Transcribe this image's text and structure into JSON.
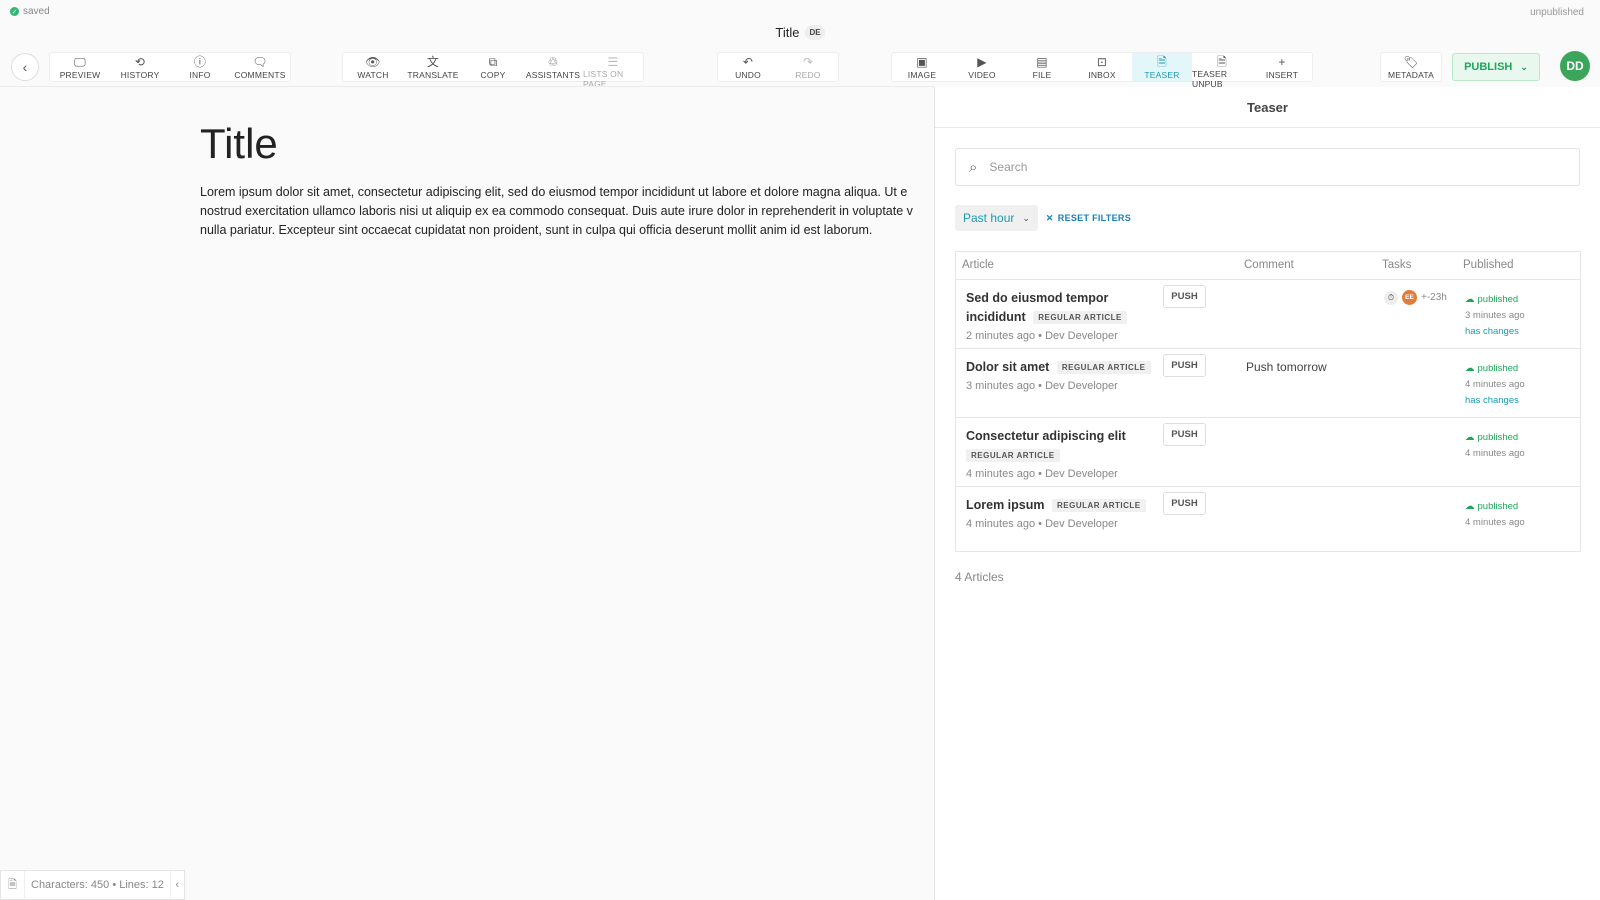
{
  "status": {
    "saved": "saved",
    "unpublished": "unpublished"
  },
  "document": {
    "title": "Title",
    "language": "DE"
  },
  "toolbar": {
    "group1": [
      {
        "icon": "preview-icon",
        "glyph": "🖵",
        "label": "PREVIEW"
      },
      {
        "icon": "history-icon",
        "glyph": "⟲",
        "label": "HISTORY"
      },
      {
        "icon": "info-icon",
        "glyph": "ⓘ",
        "label": "INFO"
      },
      {
        "icon": "comments-icon",
        "glyph": "🗨",
        "label": "COMMENTS"
      }
    ],
    "group2": [
      {
        "icon": "watch-icon",
        "glyph": "👁",
        "label": "WATCH"
      },
      {
        "icon": "translate-icon",
        "glyph": "文",
        "label": "TRANSLATE"
      },
      {
        "icon": "copy-icon",
        "glyph": "⧉",
        "label": "COPY"
      },
      {
        "icon": "assistants-icon",
        "glyph": "♲",
        "label": "ASSISTANTS"
      },
      {
        "icon": "lists-icon",
        "glyph": "☰",
        "label": "LISTS ON PAGE"
      }
    ],
    "group3": [
      {
        "icon": "undo-icon",
        "glyph": "↶",
        "label": "UNDO"
      },
      {
        "icon": "redo-icon",
        "glyph": "↷",
        "label": "REDO"
      }
    ],
    "group4": [
      {
        "icon": "image-icon",
        "glyph": "▣",
        "label": "IMAGE"
      },
      {
        "icon": "video-icon",
        "glyph": "▶",
        "label": "VIDEO"
      },
      {
        "icon": "file-icon",
        "glyph": "▤",
        "label": "FILE"
      },
      {
        "icon": "inbox-icon",
        "glyph": "⊡",
        "label": "INBOX"
      },
      {
        "icon": "teaser-icon",
        "glyph": "🗎",
        "label": "TEASER"
      },
      {
        "icon": "teaser-unpub-icon",
        "glyph": "🗎",
        "label": "TEASER UNPUB"
      },
      {
        "icon": "insert-icon",
        "glyph": "+",
        "label": "INSERT"
      }
    ],
    "metadata": {
      "icon": "tag-icon",
      "glyph": "🏷",
      "label": "METADATA"
    },
    "publish_label": "PUBLISH",
    "avatar_initials": "DD"
  },
  "editor": {
    "heading": "Title",
    "body_lines": [
      "Lorem ipsum dolor sit amet, consectetur adipiscing elit, sed do eiusmod tempor incididunt ut labore et dolore magna aliqua. Ut e",
      "nostrud exercitation ullamco laboris nisi ut aliquip ex ea commodo consequat. Duis aute irure dolor in reprehenderit in voluptate v",
      "nulla pariatur. Excepteur sint occaecat cupidatat non proident, sunt in culpa qui officia deserunt mollit anim id est laborum."
    ],
    "footer_stats": "Characters: 450 • Lines: 12"
  },
  "panel": {
    "title": "Teaser",
    "search_placeholder": "Search",
    "filter_selected": "Past hour",
    "reset_label": "RESET FILTERS",
    "columns": {
      "article": "Article",
      "comment": "Comment",
      "tasks": "Tasks",
      "published": "Published"
    },
    "rows": [
      {
        "title": "Sed do eiusmod tempor incididunt",
        "tag": "REGULAR ARTICLE",
        "meta": "2 minutes ago • Dev Developer",
        "push": "PUSH",
        "comment": "",
        "tasks_avatar": "EE",
        "tasks_time": "+-23h",
        "status": "published",
        "published_ago": "3 minutes ago",
        "changes": "has changes"
      },
      {
        "title": "Dolor sit amet",
        "tag": "REGULAR ARTICLE",
        "meta": "3 minutes ago • Dev Developer",
        "push": "PUSH",
        "comment": "Push tomorrow",
        "status": "published",
        "published_ago": "4 minutes ago",
        "changes": "has changes"
      },
      {
        "title": "Consectetur adipiscing elit",
        "tag": "REGULAR ARTICLE",
        "meta": "4 minutes ago • Dev Developer",
        "push": "PUSH",
        "comment": "",
        "status": "published",
        "published_ago": "4 minutes ago",
        "changes": ""
      },
      {
        "title": "Lorem ipsum",
        "tag": "REGULAR ARTICLE",
        "meta": "4 minutes ago • Dev Developer",
        "push": "PUSH",
        "comment": "",
        "status": "published",
        "published_ago": "4 minutes ago",
        "changes": ""
      }
    ],
    "count_label": "4 Articles"
  },
  "colors": {
    "accent": "#1a9bb3",
    "success": "#1fa65a",
    "avatar": "#3ba55c"
  }
}
